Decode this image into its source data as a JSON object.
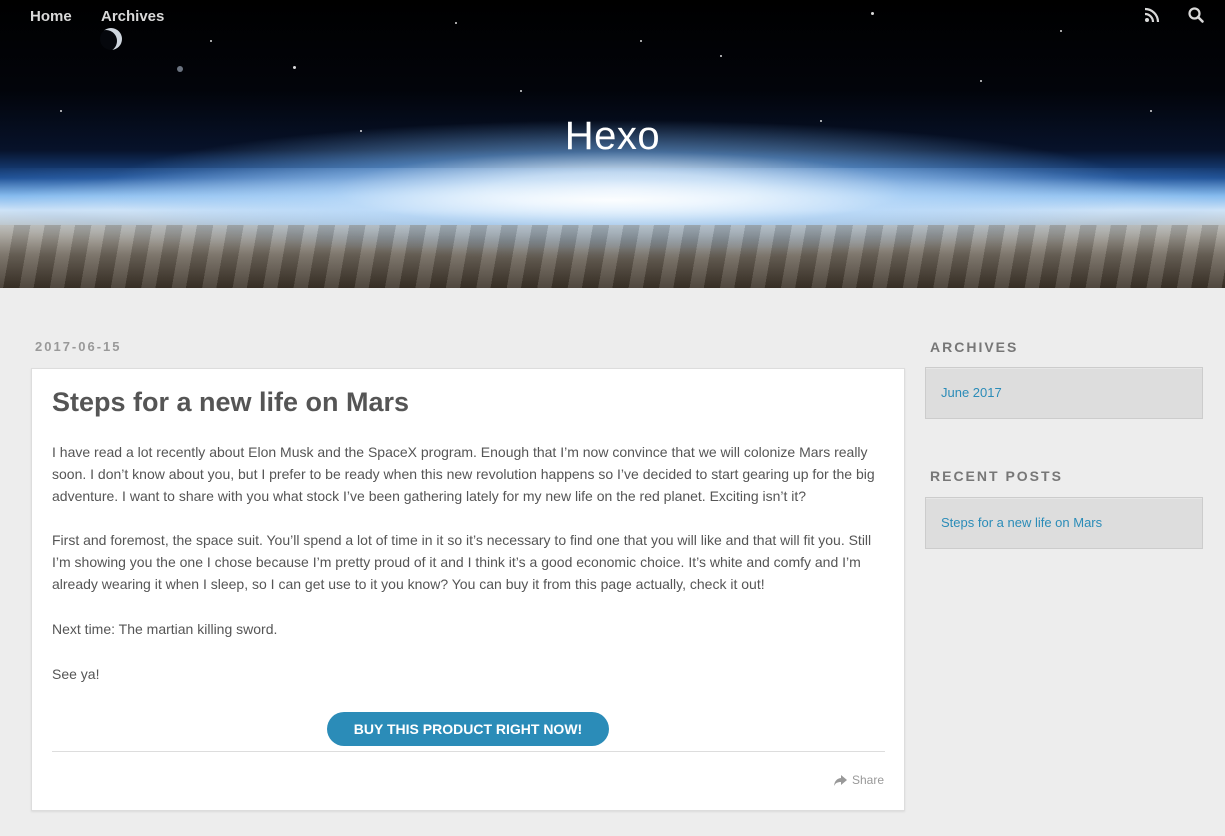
{
  "nav": {
    "home_label": "Home",
    "archives_label": "Archives",
    "icons": [
      "rss-icon",
      "search-icon"
    ]
  },
  "banner": {
    "site_title": "Hexo"
  },
  "post": {
    "date": "2017-06-15",
    "title": "Steps for a new life on Mars",
    "paragraphs": [
      "I have read a lot recently about Elon Musk and the SpaceX program. Enough that I’m now convince that we will colonize Mars really soon. I don’t know about you, but I prefer to be ready when this new revolution happens so I’ve decided to start gearing up for the big adventure. I want to share with you what stock I’ve been gathering lately for my new life on the red planet. Exciting isn’t it?",
      "First and foremost, the space suit. You’ll spend a lot of time in it so it’s necessary to find one that you will like and that will fit you. Still I’m showing you the one I chose because I’m pretty proud of it and I think it’s a good economic choice. It’s white and comfy and I’m already wearing it when I sleep, so I can get use to it you know? You can buy it from this page actually, check it out!",
      "Next time: The martian killing sword.",
      "See ya!"
    ],
    "buy_button_label": "BUY THIS PRODUCT RIGHT NOW!",
    "share_label": "Share"
  },
  "sidebar": {
    "archives_title": "ARCHIVES",
    "archives_items": [
      "June 2017"
    ],
    "recent_title": "RECENT POSTS",
    "recent_items": [
      "Steps for a new life on Mars"
    ]
  },
  "colors": {
    "accent": "#2b8cb8",
    "page_background": "#ededed",
    "text": "#555555"
  }
}
